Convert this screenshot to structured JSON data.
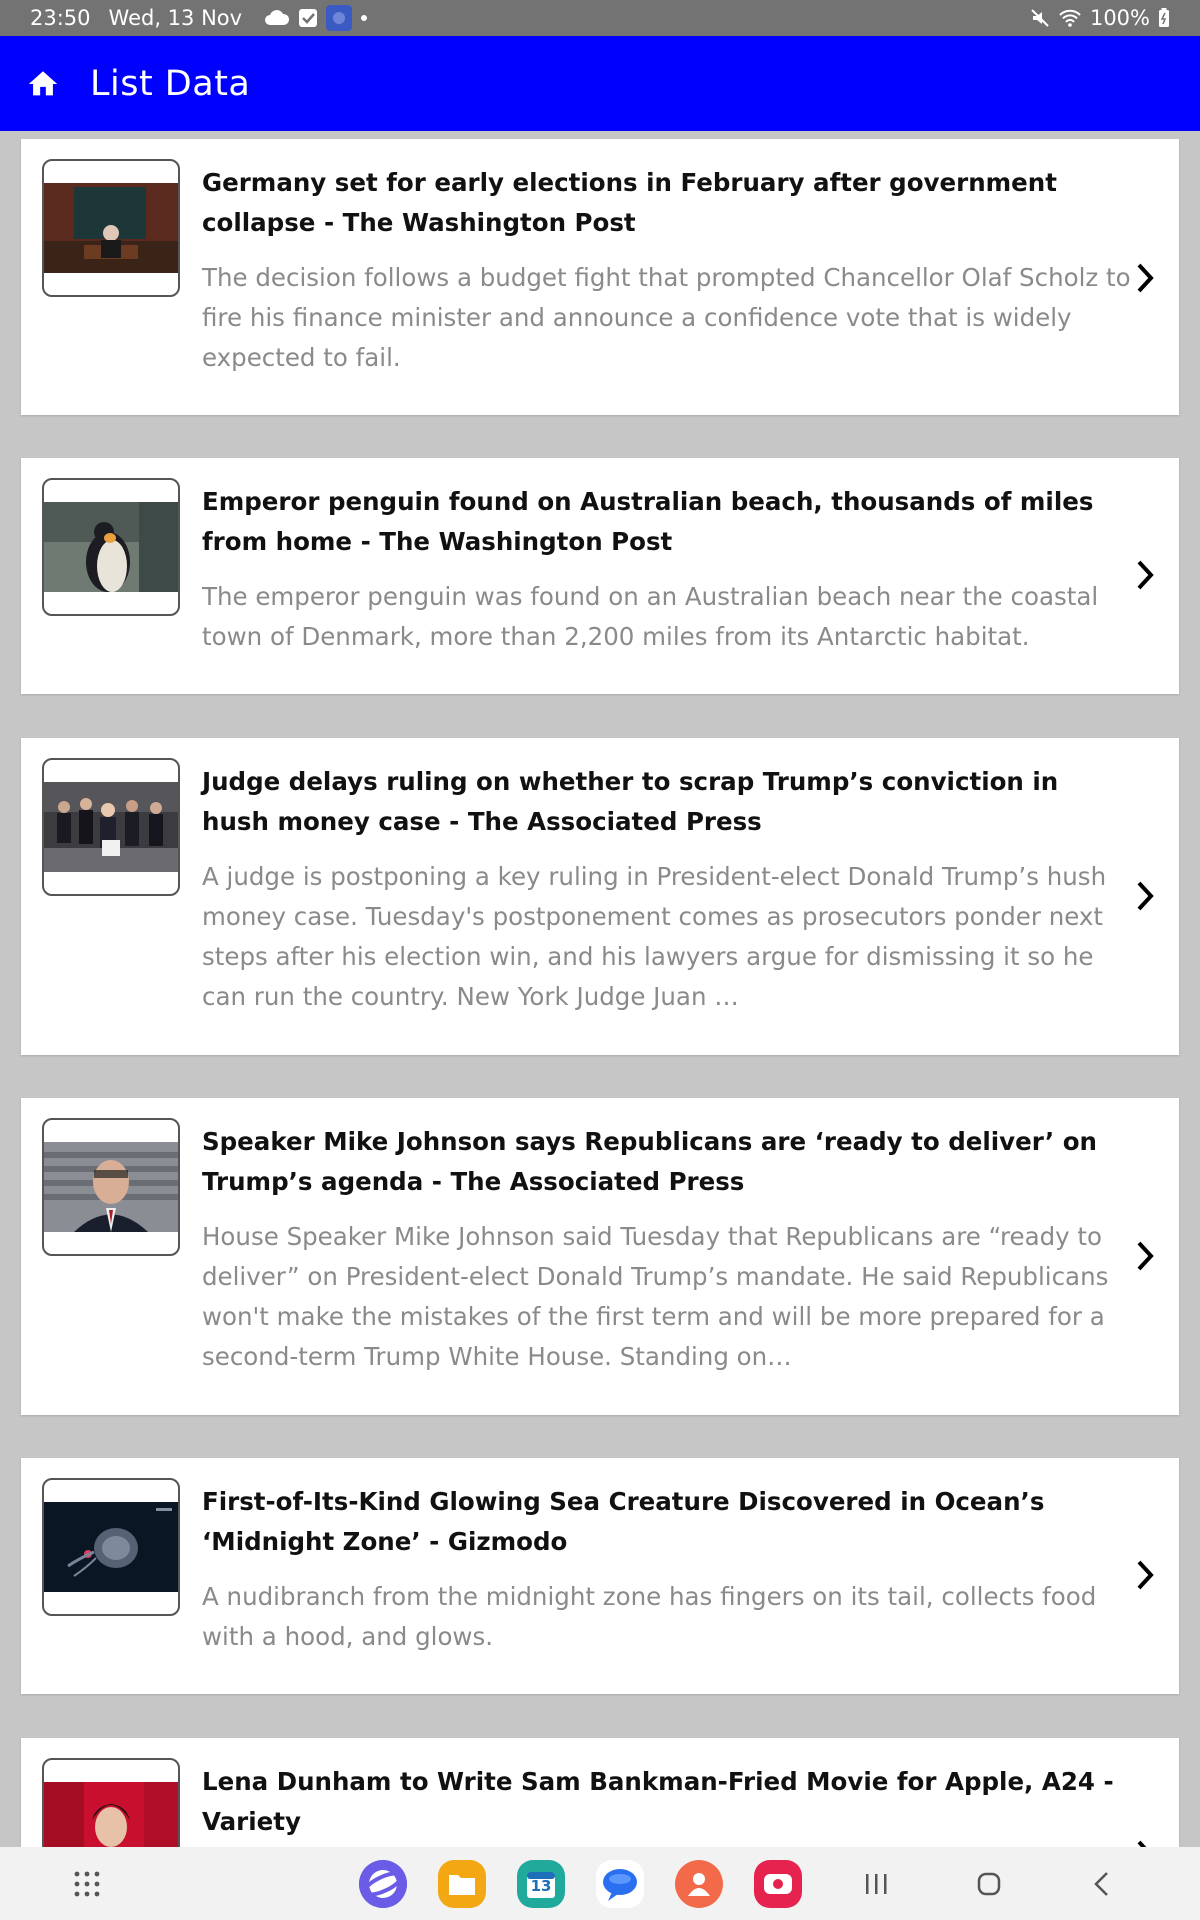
{
  "status_bar": {
    "time": "23:50",
    "date": "Wed, 13 Nov",
    "battery": "100%",
    "icons": [
      "cloud-icon",
      "checkbox-icon",
      "app-icon",
      "dot-icon",
      "mute-icon",
      "wifi-icon",
      "battery-icon"
    ]
  },
  "app_bar": {
    "title": "List Data",
    "icon": "home-icon",
    "color": "#0000ff"
  },
  "articles": [
    {
      "title": "Germany set for early elections in February after government collapse - The Washington Post",
      "description": "The decision follows a budget fight that prompted Chancellor Olaf Scholz to fire his finance minister and announce a confidence vote that is widely expected to fail."
    },
    {
      "title": "Emperor penguin found on Australian beach, thousands of miles from home - The Washington Post",
      "description": "The emperor penguin was found on an Australian beach near the coastal town of Denmark, more than 2,200 miles from its Antarctic habitat."
    },
    {
      "title": "Judge delays ruling on whether to scrap Trump’s conviction in hush money case - The Associated Press",
      "description": "A judge is postponing a key ruling in President-elect Donald Trump’s hush money case. Tuesday's postponement comes as prosecutors ponder next steps after his election win, and his lawyers argue for dismissing it so he can run the country. New York Judge Juan …"
    },
    {
      "title": "Speaker Mike Johnson says Republicans are ‘ready to deliver’ on Trump’s agenda - The Associated Press",
      "description": "House Speaker Mike Johnson said Tuesday that Republicans are “ready to deliver” on President-elect Donald Trump’s mandate. He said Republicans won't make the mistakes of the first term and will be more prepared for a second-term Trump White House. Standing on…"
    },
    {
      "title": "First-of-Its-Kind Glowing Sea Creature Discovered in Ocean’s ‘Midnight Zone’ - Gizmodo",
      "description": "A nudibranch from the midnight zone has fingers on its tail, collects food with a hood, and glows."
    },
    {
      "title": "Lena Dunham to Write Sam Bankman-Fried Movie for Apple, A24 - Variety",
      "description": ""
    }
  ],
  "nav_bar": {
    "apps": [
      "apps-grid-icon",
      "internet-browser-icon",
      "my-files-icon",
      "calendar-icon",
      "messages-icon",
      "contacts-icon",
      "screen-recorder-icon"
    ],
    "calendar_day": "13",
    "buttons": [
      "recent-apps-button",
      "home-button",
      "back-button"
    ]
  }
}
